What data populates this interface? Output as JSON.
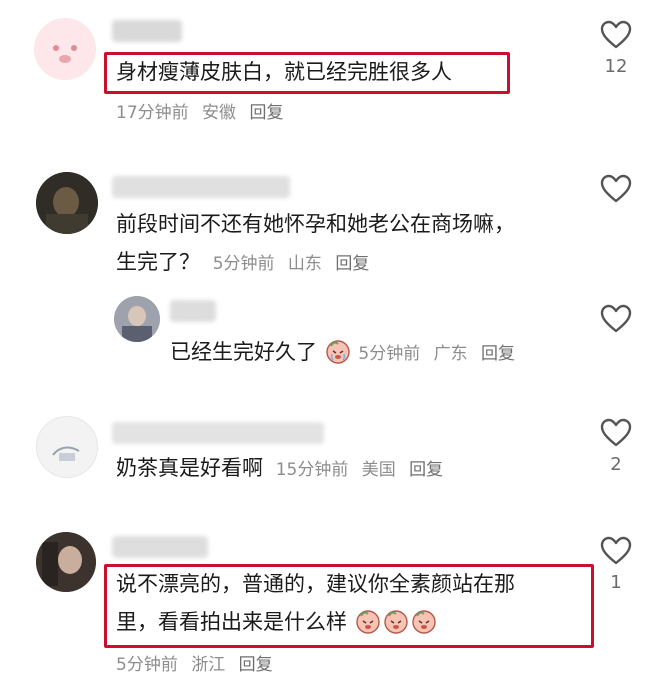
{
  "comments": [
    {
      "text": "身材瘦薄皮肤白，就已经完胜很多人",
      "time": "17分钟前",
      "location": "安徽",
      "reply": "回复",
      "likes": "12"
    },
    {
      "text_line1": "前段时间不还有她怀孕和她老公在商场嘛，",
      "text_line2": "生完了？",
      "time": "5分钟前",
      "location": "山东",
      "reply": "回复",
      "reply_item": {
        "text": "已经生完好久了",
        "time": "5分钟前",
        "location": "广东",
        "reply": "回复"
      }
    },
    {
      "text": "奶茶真是好看啊",
      "time": "15分钟前",
      "location": "美国",
      "reply": "回复",
      "likes": "2"
    },
    {
      "text_line1": "说不漂亮的，普通的，建议你全素颜站在那",
      "text_line2": "里，看看拍出来是什么样",
      "time": "5分钟前",
      "location": "浙江",
      "reply": "回复",
      "likes": "1"
    }
  ],
  "colors": {
    "highlight": "#c8102e",
    "meta": "#8d8d8d",
    "icon": "#555555"
  },
  "icons": {
    "like": "heart-outline-icon",
    "emoji": "crying-peach-emoji"
  }
}
